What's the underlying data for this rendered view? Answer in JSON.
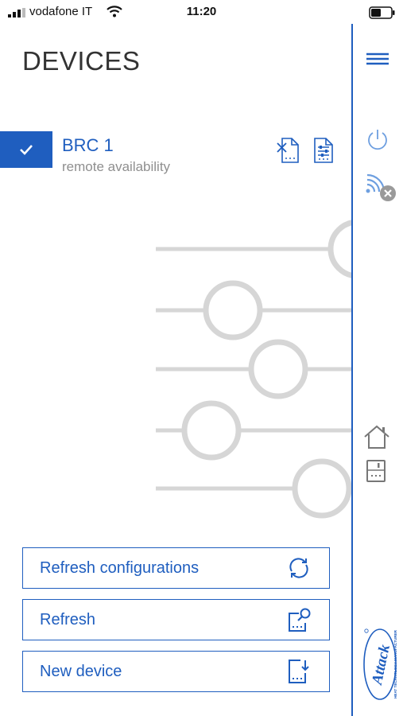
{
  "status_bar": {
    "carrier": "vodafone IT",
    "time": "11:20",
    "icons": [
      "signal-icon",
      "wifi-icon",
      "battery-icon"
    ]
  },
  "page": {
    "title": "DEVICES"
  },
  "devices": [
    {
      "name": "BRC 1",
      "subtitle": "remote availability",
      "selected": true,
      "actions": [
        "config-delete-icon",
        "config-settings-icon"
      ]
    }
  ],
  "sidebar": {
    "icons": [
      "menu-icon",
      "power-icon",
      "remote-disconnected-icon",
      "home-icon",
      "device-icon"
    ],
    "logo_text": "Attack",
    "logo_tagline": "HEAT TECHNOLOGY MANUFACTURER"
  },
  "actions": {
    "refresh_configurations": "Refresh configurations",
    "refresh": "Refresh",
    "new_device": "New device"
  },
  "colors": {
    "accent": "#1f5ebf",
    "subtext": "#8f8f8f",
    "illustration": "#d6d6d6",
    "disabled": "#9a9a9a"
  }
}
